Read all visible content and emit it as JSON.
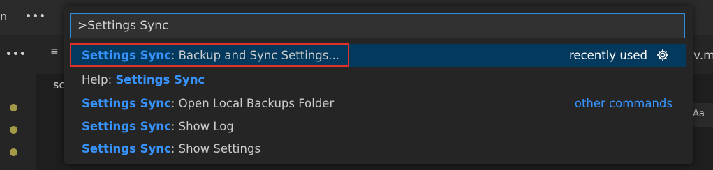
{
  "background": {
    "menu_fragment": "n",
    "more_actions": "•••",
    "tab_fragment_right": "v.m",
    "tab_fragment_below": "sc",
    "match_case_glyph": "Aa"
  },
  "palette": {
    "input_value": ">Settings Sync",
    "items": [
      {
        "highlight": "Settings Sync",
        "label": ": Backup and Sync Settings...",
        "detail": "recently used"
      },
      {
        "prefix": "Help: ",
        "highlight": "Settings Sync"
      },
      {
        "highlight": "Settings Sync",
        "label": ": Open Local Backups Folder",
        "detail": "other commands"
      },
      {
        "highlight": "Settings Sync",
        "label": ": Show Log"
      },
      {
        "highlight": "Settings Sync",
        "label": ": Show Settings"
      }
    ]
  },
  "colors": {
    "accent": "#3794ff",
    "selected_row": "#04395e",
    "focus_border": "#2f8cd8",
    "annotation_box": "#e0312a"
  }
}
